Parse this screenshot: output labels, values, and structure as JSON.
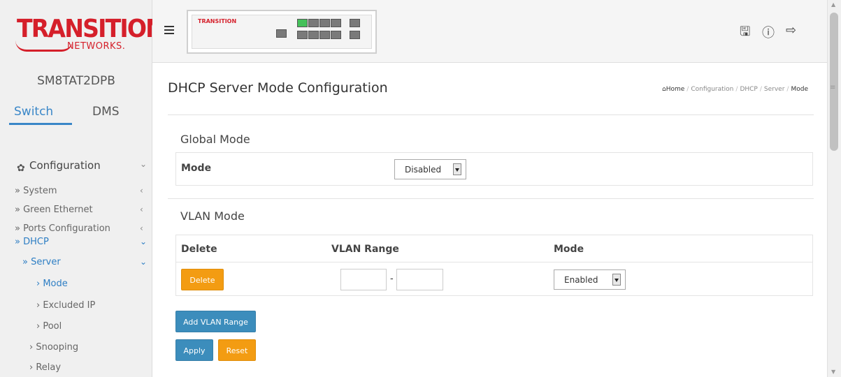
{
  "brand": {
    "logo_text_top": "TRANSITION",
    "logo_text_bottom": "NETWORKS.",
    "accent": "#d51f2a"
  },
  "device_name": "SM8TAT2DPB",
  "mode_tabs": {
    "active": "Switch",
    "other": "DMS"
  },
  "sidebar": {
    "section": "Configuration",
    "items": [
      {
        "label": "» System",
        "chevron": "‹"
      },
      {
        "label": "» Green Ethernet",
        "chevron": "‹"
      },
      {
        "label": "» Ports Configuration",
        "chevron": "‹"
      },
      {
        "label": "» DHCP",
        "chevron": "⌄"
      },
      {
        "label": "» Server",
        "chevron": "⌄"
      },
      {
        "label": "› Mode"
      },
      {
        "label": "› Excluded IP"
      },
      {
        "label": "› Pool"
      },
      {
        "label": "› Snooping"
      },
      {
        "label": "› Relay"
      }
    ]
  },
  "topbar": {
    "device_logo": "TRANSITION",
    "icons": [
      "save-icon",
      "help-icon",
      "logout-icon"
    ]
  },
  "page": {
    "title": "DHCP Server Mode Configuration",
    "breadcrumb": [
      "Home",
      "Configuration",
      "DHCP",
      "Server",
      "Mode"
    ]
  },
  "global_mode": {
    "title": "Global Mode",
    "label": "Mode",
    "value": "Disabled"
  },
  "vlan_mode": {
    "title": "VLAN Mode",
    "headers": [
      "Delete",
      "VLAN Range",
      "Mode"
    ],
    "row": {
      "delete_label": "Delete",
      "range_start": "",
      "range_end": "",
      "range_sep": "-",
      "mode": "Enabled"
    },
    "add_label": "Add VLAN Range"
  },
  "actions": {
    "apply": "Apply",
    "reset": "Reset"
  },
  "colors": {
    "link_blue": "#3a87c8",
    "button_blue": "#3c8dbc",
    "button_orange": "#f39c12"
  }
}
